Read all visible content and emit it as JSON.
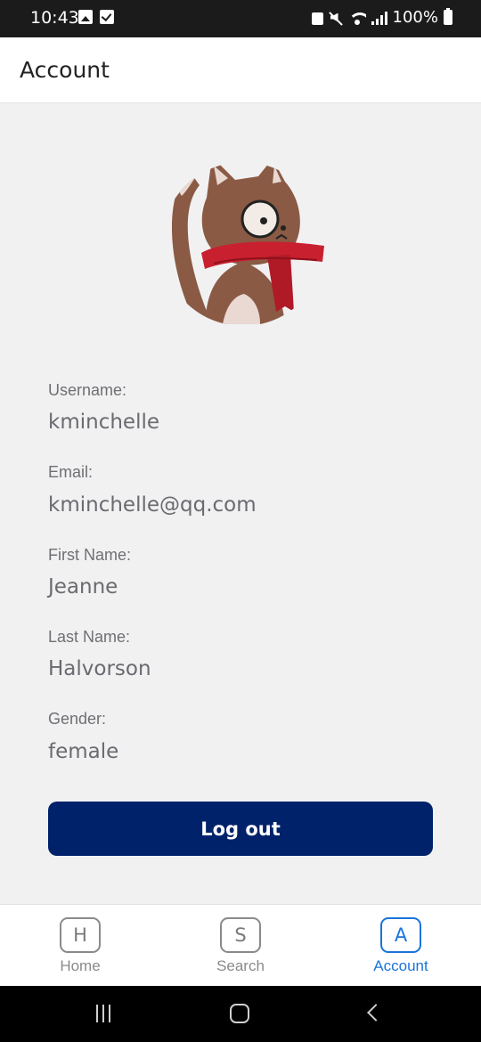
{
  "status_bar": {
    "time": "10:43",
    "battery": "100%",
    "left_icons": [
      "gallery-icon",
      "checkbox-icon"
    ],
    "right_icons": [
      "lock-icon",
      "mute-icon",
      "wifi-icon",
      "signal-icon",
      "battery-icon"
    ]
  },
  "header": {
    "title": "Account"
  },
  "profile": {
    "avatar_icon": "cat-with-monocle-and-scarf",
    "fields": [
      {
        "label": "Username:",
        "value": "kminchelle"
      },
      {
        "label": "Email:",
        "value": "kminchelle@qq.com"
      },
      {
        "label": "First Name:",
        "value": "Jeanne"
      },
      {
        "label": "Last Name:",
        "value": "Halvorson"
      },
      {
        "label": "Gender:",
        "value": "female"
      }
    ]
  },
  "logout": {
    "label": "Log out",
    "color": "#00226b"
  },
  "bottom_nav": {
    "active_color": "#1a74d8",
    "items": [
      {
        "key": "H",
        "label": "Home",
        "active": false
      },
      {
        "key": "S",
        "label": "Search",
        "active": false
      },
      {
        "key": "A",
        "label": "Account",
        "active": true
      }
    ]
  },
  "system_nav": {
    "buttons": [
      "recent-apps-icon",
      "home-icon",
      "back-icon"
    ]
  }
}
